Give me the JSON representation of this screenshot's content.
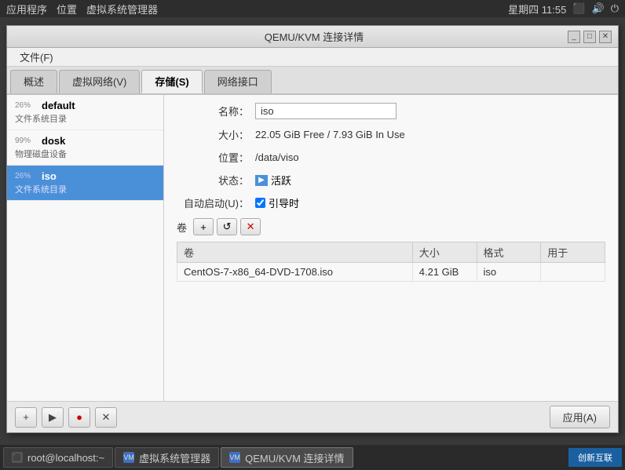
{
  "topbar": {
    "left_items": [
      "应用程序",
      "位置",
      "虚拟系统管理器"
    ],
    "time": "星期四 11:55",
    "right_icons": [
      "screen-icon",
      "volume-icon",
      "power-icon"
    ]
  },
  "window": {
    "title": "QEMU/KVM 连接详情",
    "menu": {
      "file_label": "文件(F)"
    },
    "tabs": [
      {
        "label": "概述"
      },
      {
        "label": "虚拟网络(V)"
      },
      {
        "label": "存储(S)",
        "active": true
      },
      {
        "label": "网络接口"
      }
    ]
  },
  "storage_list": [
    {
      "id": "default",
      "name": "default",
      "type": "文件系统目录",
      "percent": "26%",
      "selected": false
    },
    {
      "id": "dosk",
      "name": "dosk",
      "type": "物理磁盘设备",
      "percent": "99%",
      "selected": false
    },
    {
      "id": "iso",
      "name": "iso",
      "type": "文件系统目录",
      "percent": "26%",
      "selected": true
    }
  ],
  "detail": {
    "name_label": "名称：",
    "name_value": "iso",
    "size_label": "大小：",
    "size_value": "22.05 GiB Free / 7.93 GiB In Use",
    "location_label": "位置：",
    "location_value": "/data/viso",
    "status_label": "状态：",
    "status_value": "活跃",
    "autostart_label": "自动启动(U)：",
    "autostart_value": "引导时",
    "volumes_label": "卷"
  },
  "toolbar": {
    "add_label": "+",
    "refresh_label": "↺",
    "remove_label": "✕"
  },
  "volumes_table": {
    "headers": [
      "卷",
      "大小",
      "格式",
      "用于"
    ],
    "rows": [
      {
        "name": "CentOS-7-x86_64-DVD-1708.iso",
        "size": "4.21 GiB",
        "format": "iso",
        "use": ""
      }
    ]
  },
  "bottom": {
    "apply_label": "应用(A)",
    "btn_add": "+",
    "btn_play": "▶",
    "btn_stop": "●",
    "btn_close": "✕"
  },
  "taskbar": {
    "items": [
      {
        "label": "root@localhost:~",
        "icon_type": "terminal"
      },
      {
        "label": "虚拟系统管理器",
        "icon_type": "blue"
      },
      {
        "label": "QEMU/KVM 连接详情",
        "icon_type": "blue",
        "active": true
      }
    ],
    "watermark": "创新互联"
  }
}
